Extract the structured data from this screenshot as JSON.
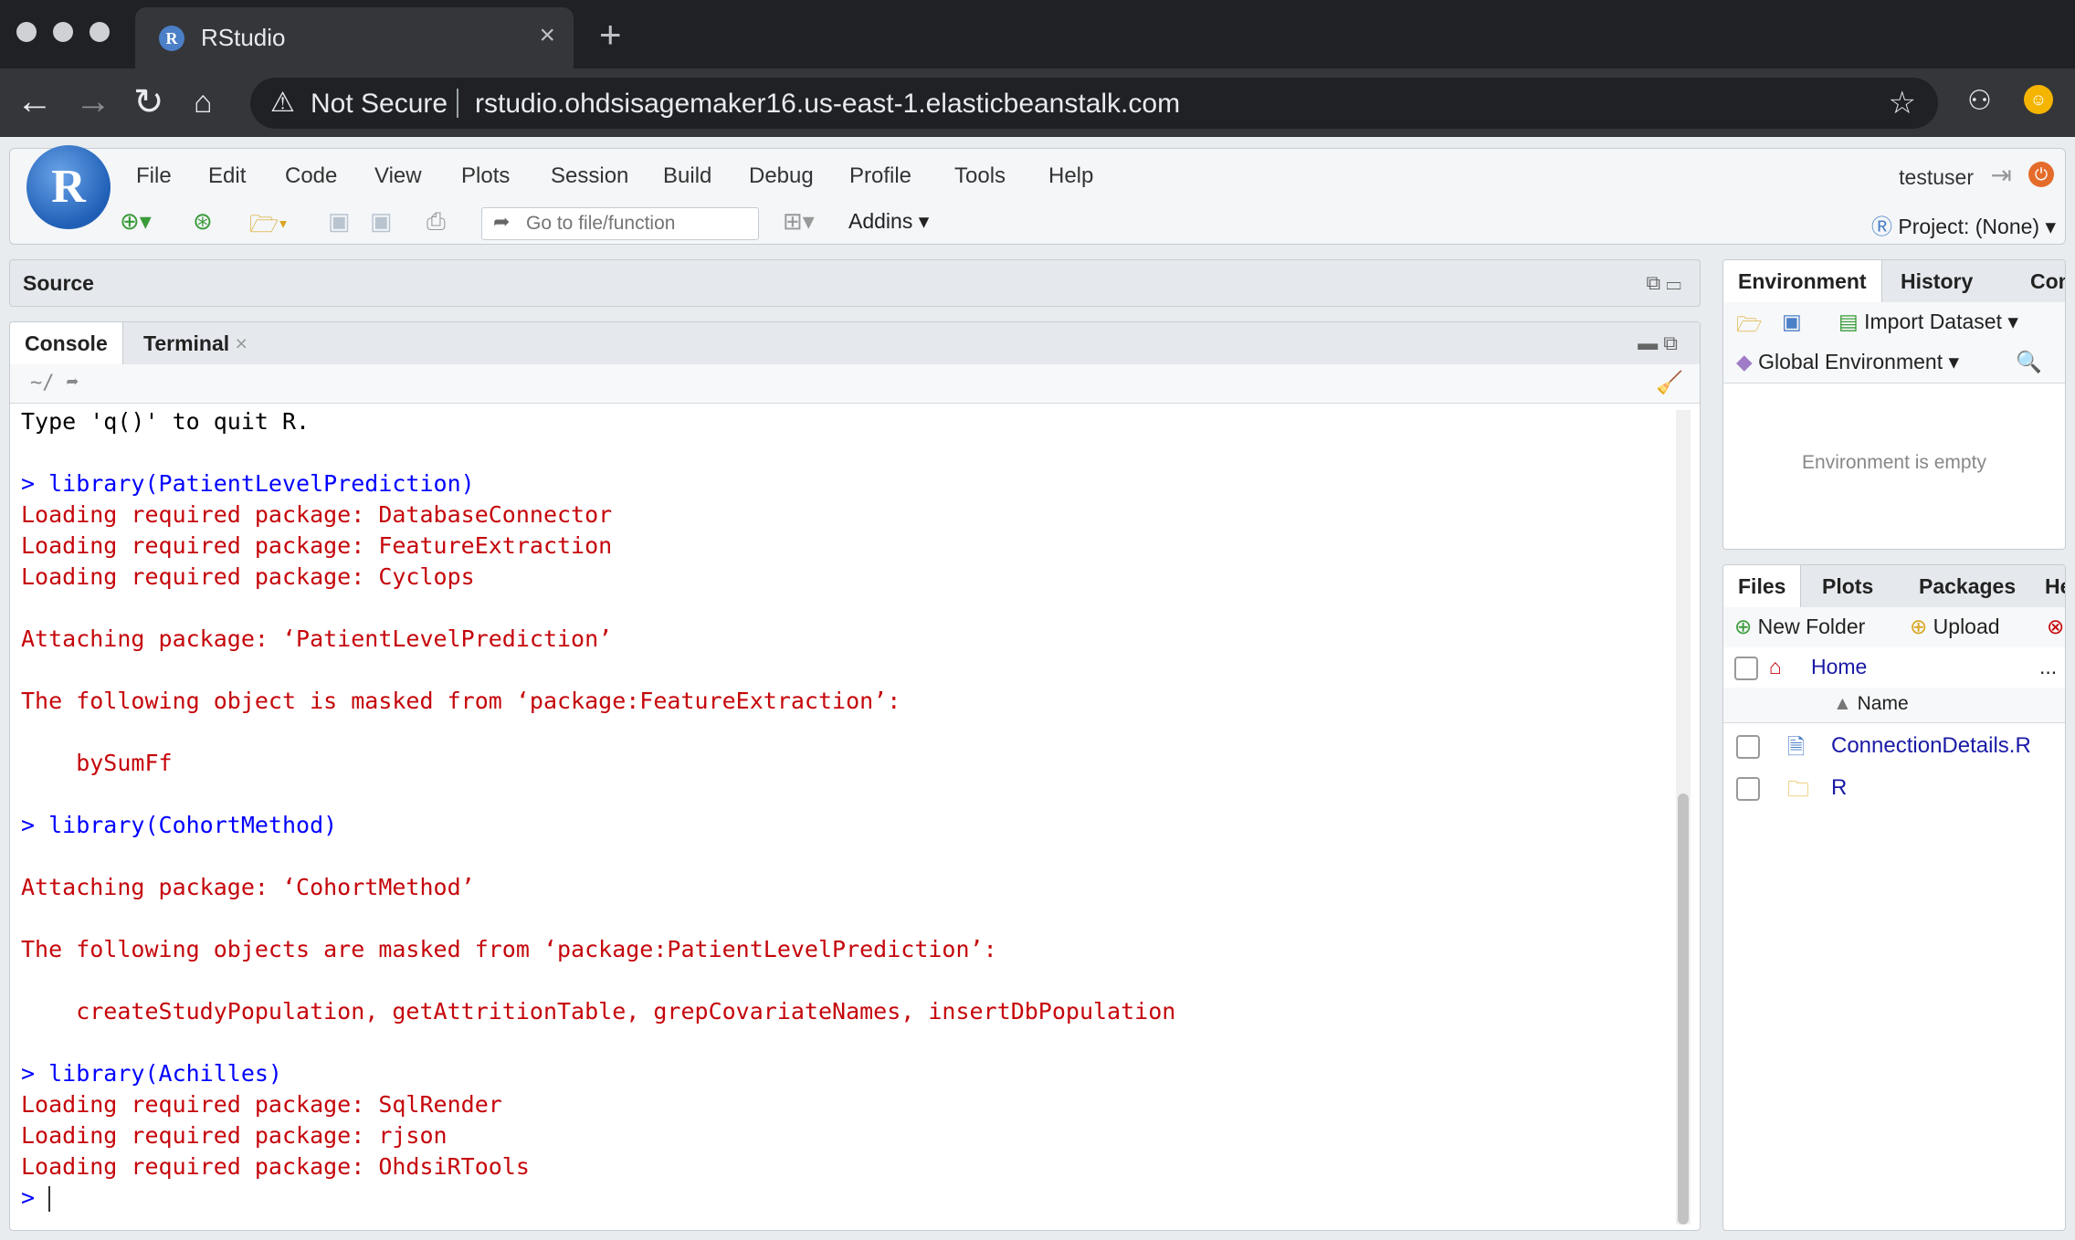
{
  "browser": {
    "tab_title": "RStudio",
    "tab_favicon": "R",
    "close_glyph": "×",
    "newtab_glyph": "+",
    "security_label": "Not Secure",
    "url": "rstudio.ohdsisagemaker16.us-east-1.elasticbeanstalk.com",
    "icons": [
      "back-icon",
      "forward-icon",
      "reload-icon",
      "home-icon",
      "warning-icon",
      "star-icon",
      "extension-icon",
      "profile-avatar"
    ]
  },
  "rstudio": {
    "logo_letter": "R",
    "menu": [
      "File",
      "Edit",
      "Code",
      "View",
      "Plots",
      "Session",
      "Build",
      "Debug",
      "Profile",
      "Tools",
      "Help"
    ],
    "user": "testuser",
    "goto_placeholder": "Go to file/function",
    "addins_label": "Addins",
    "project_label": "Project: (None)"
  },
  "source_pane": {
    "title": "Source"
  },
  "console_pane": {
    "tabs": [
      "Console",
      "Terminal"
    ],
    "path": "~/",
    "lines": [
      {
        "type": "out",
        "text": "Type 'q()' to quit R."
      },
      {
        "type": "blank",
        "text": ""
      },
      {
        "type": "cmd",
        "text": "> library(PatientLevelPrediction)"
      },
      {
        "type": "msg",
        "text": "Loading required package: DatabaseConnector"
      },
      {
        "type": "msg",
        "text": "Loading required package: FeatureExtraction"
      },
      {
        "type": "msg",
        "text": "Loading required package: Cyclops"
      },
      {
        "type": "blank",
        "text": ""
      },
      {
        "type": "msg",
        "text": "Attaching package: ‘PatientLevelPrediction’"
      },
      {
        "type": "blank",
        "text": ""
      },
      {
        "type": "msg",
        "text": "The following object is masked from ‘package:FeatureExtraction’:"
      },
      {
        "type": "blank",
        "text": ""
      },
      {
        "type": "msg",
        "text": "    bySumFf"
      },
      {
        "type": "blank",
        "text": ""
      },
      {
        "type": "cmd",
        "text": "> library(CohortMethod)"
      },
      {
        "type": "blank",
        "text": ""
      },
      {
        "type": "msg",
        "text": "Attaching package: ‘CohortMethod’"
      },
      {
        "type": "blank",
        "text": ""
      },
      {
        "type": "msg",
        "text": "The following objects are masked from ‘package:PatientLevelPrediction’:"
      },
      {
        "type": "blank",
        "text": ""
      },
      {
        "type": "msg",
        "text": "    createStudyPopulation, getAttritionTable, grepCovariateNames, insertDbPopulation"
      },
      {
        "type": "blank",
        "text": ""
      },
      {
        "type": "cmd",
        "text": "> library(Achilles)"
      },
      {
        "type": "msg",
        "text": "Loading required package: SqlRender"
      },
      {
        "type": "msg",
        "text": "Loading required package: rjson"
      },
      {
        "type": "msg",
        "text": "Loading required package: OhdsiRTools"
      },
      {
        "type": "cmd",
        "text": "> "
      }
    ]
  },
  "env_pane": {
    "tabs": [
      "Environment",
      "History",
      "Conn"
    ],
    "import_label": "Import Dataset",
    "scope_label": "Global Environment",
    "empty_text": "Environment is empty"
  },
  "files_pane": {
    "tabs": [
      "Files",
      "Plots",
      "Packages",
      "He"
    ],
    "new_folder_label": "New Folder",
    "upload_label": "Upload",
    "breadcrumb": "Home",
    "more_label": "...",
    "name_header": "Name",
    "sort_glyph": "▲",
    "files": [
      {
        "name": "ConnectionDetails.R",
        "icon": "r-file-icon"
      },
      {
        "name": "R",
        "icon": "folder-icon"
      }
    ]
  },
  "colors": {
    "console_command": "#0000ff",
    "console_message": "#c5060b",
    "console_output": "#000000",
    "file_link": "#1a1aa6"
  }
}
